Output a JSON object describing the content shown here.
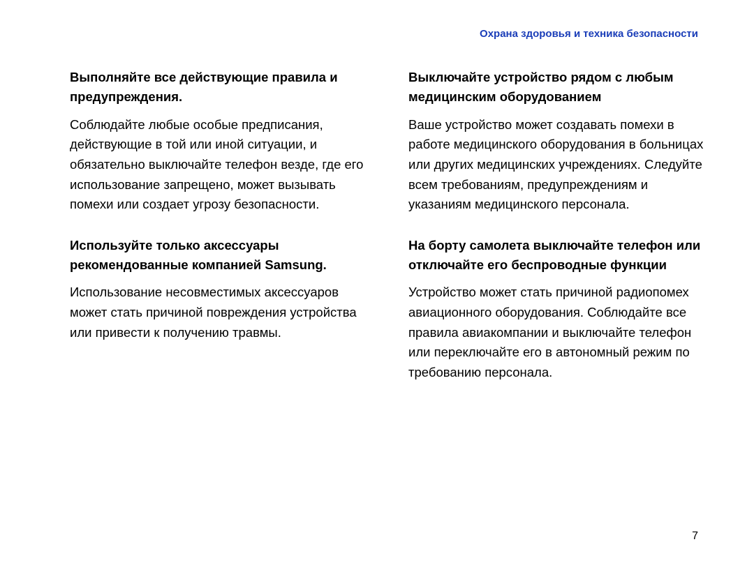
{
  "header": "Охрана здоровья и техника безопасности",
  "left": {
    "s1": {
      "heading": "Выполняйте все действующие правила и предупреждения.",
      "body": "Соблюдайте любые особые предписания, действующие в той или иной ситуации, и обязательно выключайте телефон везде, где его использование запрещено, может вызывать помехи или создает угрозу безопасности."
    },
    "s2": {
      "heading": "Используйте только аксессуары рекомендованные компанией Samsung.",
      "body": "Использование несовместимых аксессуаров может стать причиной повреждения устройства или привести к получению травмы."
    }
  },
  "right": {
    "s1": {
      "heading": "Выключайте устройство рядом с любым медицинским оборудованием",
      "body": "Ваше устройство может создавать помехи в работе медицинского оборудования в больницах или других медицинских учреждениях. Следуйте всем требованиям, предупреждениям и указаниям медицинского персонала."
    },
    "s2": {
      "heading": "На борту самолета выключайте телефон или отключайте его беспроводные функции",
      "body": "Устройство может стать причиной радиопомех авиационного оборудования. Соблюдайте все правила авиакомпании и выключайте телефон или переключайте его в автономный режим по требованию персонала."
    }
  },
  "pageNumber": "7"
}
